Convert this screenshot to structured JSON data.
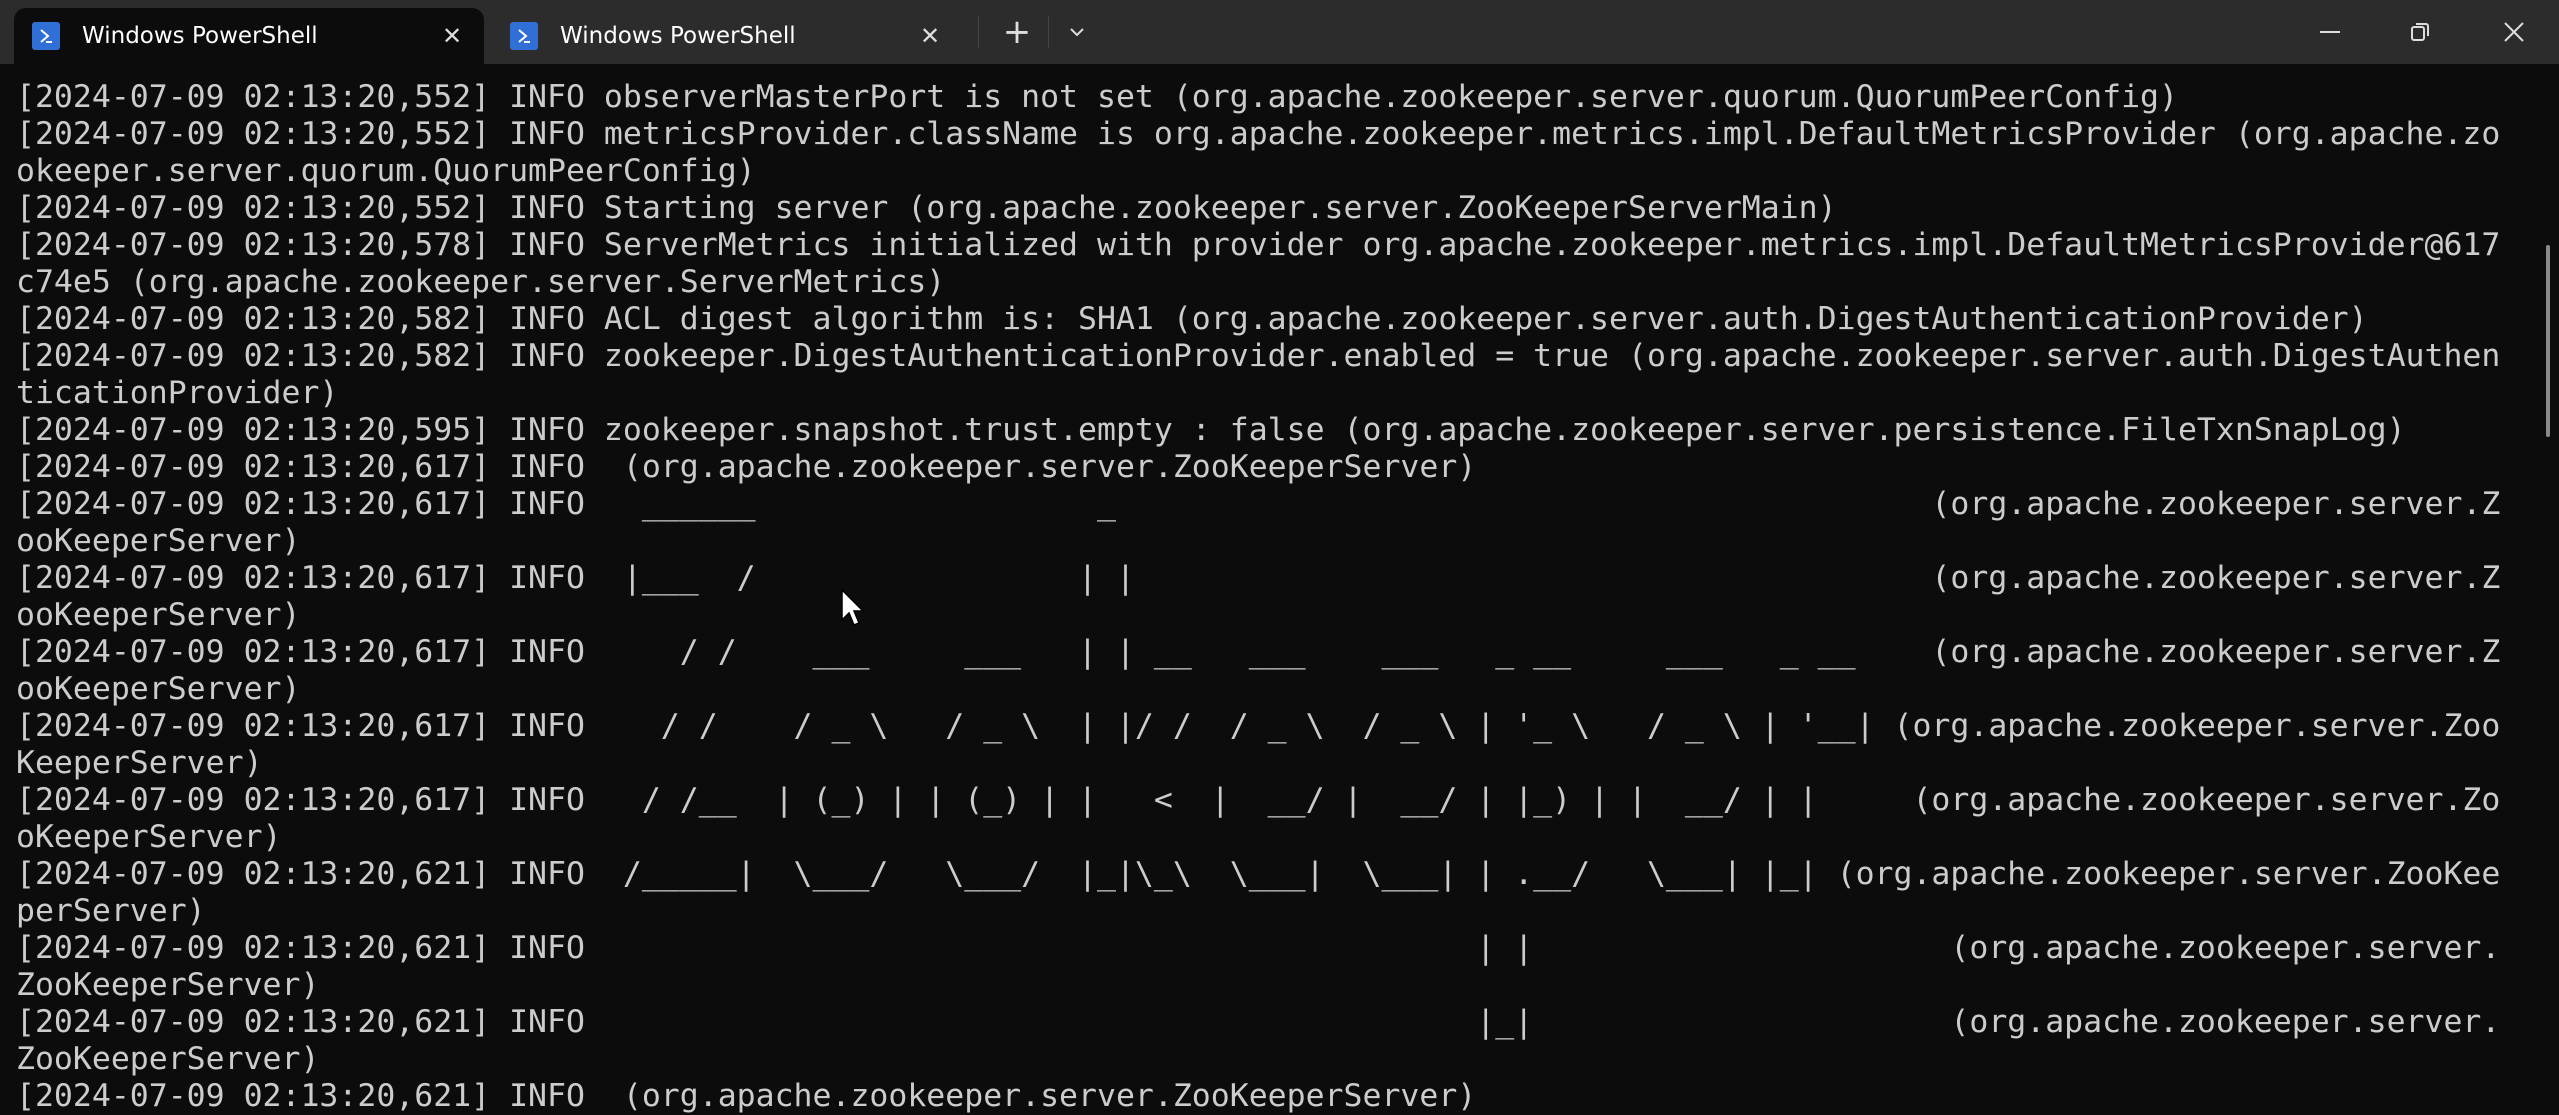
{
  "window": {
    "tabs": [
      {
        "label": "Windows PowerShell",
        "active": true,
        "icon": "powershell-icon"
      },
      {
        "label": "Windows PowerShell",
        "active": false,
        "icon": "powershell-icon"
      }
    ],
    "new_tab_glyph": "+",
    "dropdown_glyph": "⌄",
    "close_glyph": "✕",
    "minimize_glyph": "—",
    "accent": "#2f6fd6"
  },
  "terminal": {
    "columns": 131,
    "lines": [
      "[2024-07-09 02:13:20,552] INFO observerMasterPort is not set (org.apache.zookeeper.server.quorum.QuorumPeerConfig)",
      "[2024-07-09 02:13:20,552] INFO metricsProvider.className is org.apache.zookeeper.metrics.impl.DefaultMetricsProvider (org.apache.zookeeper.server.quorum.QuorumPeerConfig)",
      "[2024-07-09 02:13:20,552] INFO Starting server (org.apache.zookeeper.server.ZooKeeperServerMain)",
      "[2024-07-09 02:13:20,578] INFO ServerMetrics initialized with provider org.apache.zookeeper.metrics.impl.DefaultMetricsProvider@617c74e5 (org.apache.zookeeper.server.ServerMetrics)",
      "[2024-07-09 02:13:20,582] INFO ACL digest algorithm is: SHA1 (org.apache.zookeeper.server.auth.DigestAuthenticationProvider)",
      "[2024-07-09 02:13:20,582] INFO zookeeper.DigestAuthenticationProvider.enabled = true (org.apache.zookeeper.server.auth.DigestAuthenticationProvider)",
      "[2024-07-09 02:13:20,595] INFO zookeeper.snapshot.trust.empty : false (org.apache.zookeeper.server.persistence.FileTxnSnapLog)",
      "[2024-07-09 02:13:20,617] INFO  (org.apache.zookeeper.server.ZooKeeperServer)",
      "[2024-07-09 02:13:20,617] INFO   ______                  _                                           (org.apache.zookeeper.server.ZooKeeperServer)",
      "[2024-07-09 02:13:20,617] INFO  |___  /                 | |                                          (org.apache.zookeeper.server.ZooKeeperServer)",
      "[2024-07-09 02:13:20,617] INFO     / /    ___     ___   | | __   ___    ___   _ __     ___   _ __    (org.apache.zookeeper.server.ZooKeeperServer)",
      "[2024-07-09 02:13:20,617] INFO    / /    / _ \\   / _ \\  | |/ /  / _ \\  / _ \\ | '_ \\   / _ \\ | '__| (org.apache.zookeeper.server.ZooKeeperServer)",
      "[2024-07-09 02:13:20,617] INFO   / /__  | (_) | | (_) | |   <  |  __/ |  __/ | |_) | |  __/ | |     (org.apache.zookeeper.server.ZooKeeperServer)",
      "[2024-07-09 02:13:20,621] INFO  /_____|  \\___/   \\___/  |_|\\_\\  \\___|  \\___| | .__/   \\___| |_| (org.apache.zookeeper.server.ZooKeeperServer)",
      "[2024-07-09 02:13:20,621] INFO                                               | |                      (org.apache.zookeeper.server.ZooKeeperServer)",
      "[2024-07-09 02:13:20,621] INFO                                               |_|                      (org.apache.zookeeper.server.ZooKeeperServer)",
      "[2024-07-09 02:13:20,621] INFO  (org.apache.zookeeper.server.ZooKeeperServer)"
    ]
  }
}
